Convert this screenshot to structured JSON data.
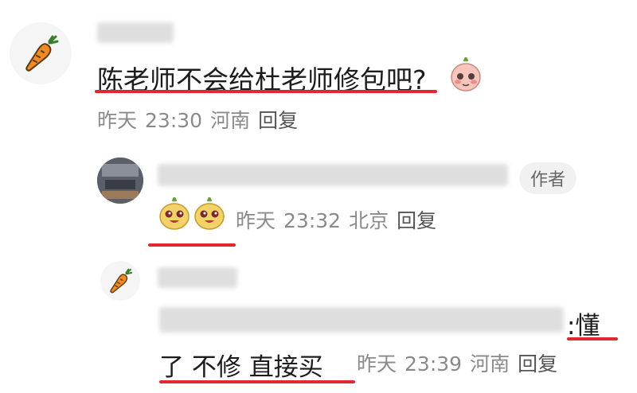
{
  "comment": {
    "text": "陈老师不会给杜老师修包吧?",
    "time_label": "昨天",
    "time": "23:30",
    "location": "河南",
    "reply_label": "回复"
  },
  "reply1": {
    "author_badge": "作者",
    "time_label": "昨天",
    "time": "23:32",
    "location": "北京",
    "reply_label": "回复"
  },
  "reply2": {
    "visible_fragment_1": "懂",
    "visible_fragment_2": "了 不修 直接买",
    "time_label": "昨天",
    "time": "23:39",
    "location": "河南",
    "reply_label": "回复"
  },
  "colors": {
    "underline": "#e0282e",
    "meta_text": "#8a8a8a",
    "carrot": "#f08a24"
  }
}
